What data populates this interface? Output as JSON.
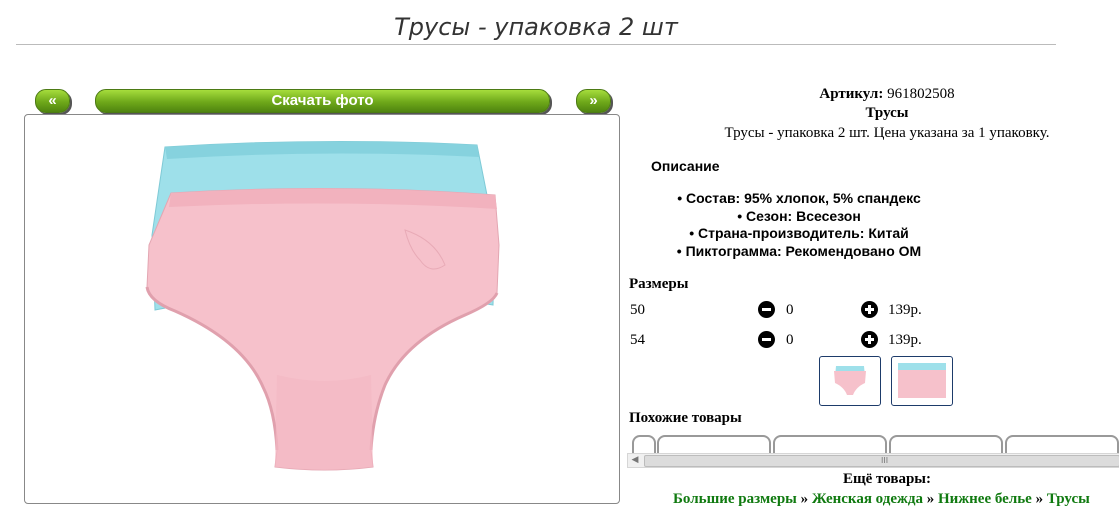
{
  "page": {
    "title": "Трусы - упаковка 2 шт"
  },
  "gallery": {
    "prev_label": "«",
    "download_label": "Скачать фото",
    "next_label": "»",
    "colors": {
      "button_green": "#6ea81a",
      "pink": "#f6c1cb",
      "blue": "#9ee0ea"
    }
  },
  "product": {
    "article_label": "Артикул:",
    "article_value": "961802508",
    "name": "Трусы",
    "description": "Трусы - упаковка 2 шт. Цена указана за 1 упаковку.",
    "description_heading": "Описание",
    "properties": [
      "Состав: 95% хлопок, 5% спандекс",
      "Сезон: Всесезон",
      "Страна-производитель: Китай",
      "Пиктограмма: Рекомендовано ОМ"
    ]
  },
  "sizes": {
    "heading": "Размеры",
    "rows": [
      {
        "size": "50",
        "qty": "0",
        "price": "139р."
      },
      {
        "size": "54",
        "qty": "0",
        "price": "139р."
      }
    ]
  },
  "similar": {
    "heading": "Похожие товары",
    "scroll_grip": "III",
    "scroll_left": "◀"
  },
  "more": {
    "heading": "Ещё товары:",
    "breadcrumbs": [
      "Большие размеры",
      "Женская одежда",
      "Нижнее белье",
      "Трусы"
    ],
    "separator": "»",
    "link_color": "#107a10"
  }
}
